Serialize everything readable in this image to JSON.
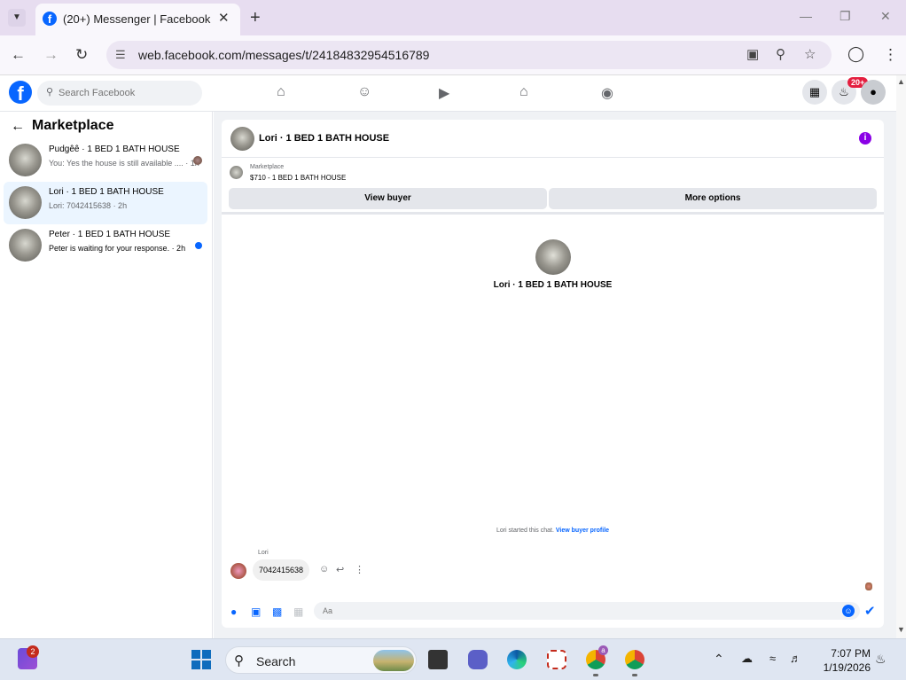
{
  "browser": {
    "tab_title": "(20+) Messenger | Facebook",
    "url": "web.facebook.com/messages/t/24184832954516789",
    "icons": [
      "tab-menu-icon",
      "facebook-favicon-icon",
      "close-icon",
      "plus-icon",
      "minimize-icon",
      "restore-icon",
      "close-window-icon",
      "back-icon",
      "forward-icon",
      "reload-icon",
      "site-info-icon",
      "install-app-icon",
      "zoom-icon",
      "star-icon",
      "profile-icon",
      "menu-dots-icon"
    ]
  },
  "facebook": {
    "logo": "f",
    "search_placeholder": "Search Facebook",
    "notification_badge": "20+",
    "nav": [
      "home-icon",
      "friends-icon",
      "video-icon",
      "marketplace-icon",
      "gaming-icon"
    ]
  },
  "sidebar": {
    "title": "Marketplace",
    "conversations": [
      {
        "name": "Pudgêê · 1 BED 1 BATH HOUSE",
        "snippet": "You: Yes the house is still available .... · 1h",
        "status": "seen"
      },
      {
        "name": "Lori · 1 BED 1 BATH HOUSE",
        "snippet": "Lori: 7042415638 · 2h",
        "status": "selected"
      },
      {
        "name": "Peter · 1 BED 1 BATH HOUSE",
        "snippet": "Peter is waiting for your response. · 2h",
        "status": "unread"
      }
    ]
  },
  "chat": {
    "title": "Lori · 1 BED 1 BATH HOUSE",
    "listing_label": "Marketplace",
    "listing_price": "$710 - 1 BED 1 BATH HOUSE",
    "view_buyer": "View buyer",
    "more_options": "More options",
    "center_name": "Lori · 1 BED 1 BATH HOUSE",
    "started_text": "Lori started this chat.",
    "view_buyer_profile": "View buyer profile",
    "sender": "Lori",
    "message": "7042415638",
    "compose_placeholder": "Aa",
    "accent": "#0866ff"
  },
  "taskbar": {
    "widgets_badge": "2",
    "search_label": "Search",
    "chrome_badge": "a",
    "time": "7:07 PM",
    "date": "1/19/2026"
  }
}
